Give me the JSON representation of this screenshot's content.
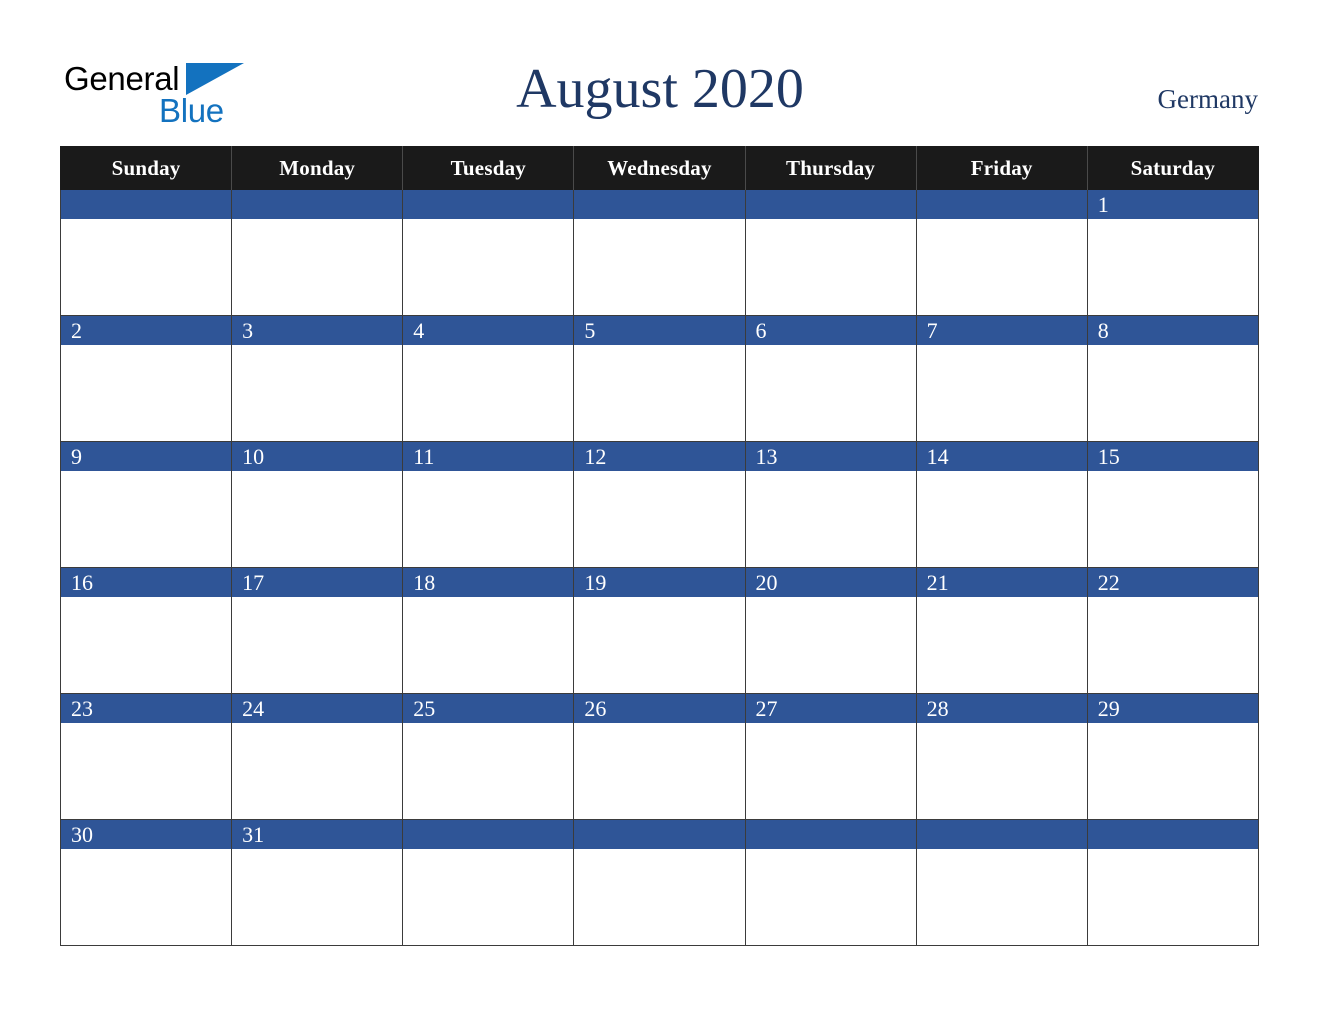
{
  "brand": {
    "name_part1": "General",
    "name_part2": "Blue",
    "logo_icon": "triangle-mark",
    "color_black": "#000000",
    "color_blue": "#1372BF"
  },
  "header": {
    "title": "August 2020",
    "country": "Germany"
  },
  "theme": {
    "header_row_bg": "#1A1A1A",
    "date_band_bg": "#2F5597",
    "title_color": "#1F3864",
    "cell_bg": "#FFFFFF",
    "grid_line": "#3B3B3B"
  },
  "calendar": {
    "month": "August",
    "year": "2020",
    "weekday_headers": [
      "Sunday",
      "Monday",
      "Tuesday",
      "Wednesday",
      "Thursday",
      "Friday",
      "Saturday"
    ],
    "weeks": [
      {
        "days": [
          "",
          "",
          "",
          "",
          "",
          "",
          "1"
        ]
      },
      {
        "days": [
          "2",
          "3",
          "4",
          "5",
          "6",
          "7",
          "8"
        ]
      },
      {
        "days": [
          "9",
          "10",
          "11",
          "12",
          "13",
          "14",
          "15"
        ]
      },
      {
        "days": [
          "16",
          "17",
          "18",
          "19",
          "20",
          "21",
          "22"
        ]
      },
      {
        "days": [
          "23",
          "24",
          "25",
          "26",
          "27",
          "28",
          "29"
        ]
      },
      {
        "days": [
          "30",
          "31",
          "",
          "",
          "",
          "",
          ""
        ]
      }
    ]
  }
}
